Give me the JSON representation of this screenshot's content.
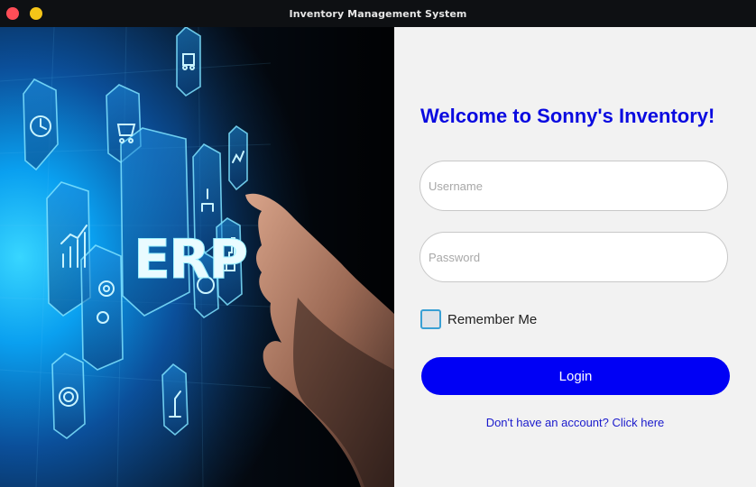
{
  "window": {
    "title": "Inventory Management System"
  },
  "hero": {
    "erp_text": "ERP"
  },
  "login": {
    "welcome": "Welcome to Sonny's Inventory!",
    "username_placeholder": "Username",
    "password_placeholder": "Password",
    "remember_label": "Remember Me",
    "remember_checked": false,
    "login_label": "Login",
    "signup_link": "Don't have an account? Click here"
  },
  "colors": {
    "accent": "#0000f5",
    "welcome": "#0a0ae0",
    "link": "#1a1acc",
    "checkbox_border": "#39a0d4"
  }
}
